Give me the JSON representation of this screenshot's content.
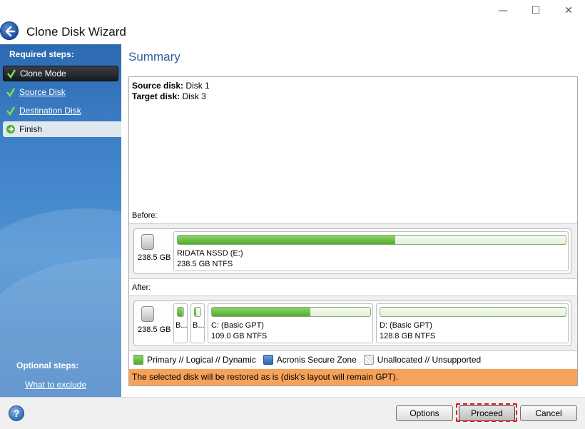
{
  "window": {
    "minimize_glyph": "—",
    "maximize_glyph": "☐",
    "close_glyph": "✕"
  },
  "header": {
    "title": "Clone Disk Wizard"
  },
  "sidebar": {
    "required_heading": "Required steps:",
    "steps": [
      {
        "label": "Clone Mode",
        "state": "completed"
      },
      {
        "label": "Source Disk",
        "state": "completed"
      },
      {
        "label": "Destination Disk",
        "state": "completed"
      },
      {
        "label": "Finish",
        "state": "current"
      }
    ],
    "optional_heading": "Optional steps:",
    "optional_link": "What to exclude"
  },
  "summary": {
    "title": "Summary",
    "source_label": "Source disk:",
    "source_value": " Disk 1",
    "target_label": "Target disk:",
    "target_value": " Disk 3",
    "before_label": "Before:",
    "after_label": "After:",
    "before": {
      "disk_size": "238.5 GB",
      "partitions": [
        {
          "name": "RIDATA NSSD (E:)",
          "info": "238.5 GB  NTFS",
          "used_fraction": 0.56
        }
      ]
    },
    "after": {
      "disk_size": "238.5 GB",
      "partitions": [
        {
          "name": "B...",
          "info": "",
          "used_fraction": 0.9
        },
        {
          "name": "B...",
          "info": "",
          "used_fraction": 0.2
        },
        {
          "name": "C: (Basic GPT)",
          "info": "109.0 GB  NTFS",
          "used_fraction": 0.62
        },
        {
          "name": "D: (Basic GPT)",
          "info": "128.8 GB  NTFS",
          "used_fraction": 0.0
        }
      ]
    },
    "legend": [
      {
        "label": "Primary // Logical // Dynamic",
        "kind": "primary"
      },
      {
        "label": "Acronis Secure Zone",
        "kind": "acronis"
      },
      {
        "label": "Unallocated // Unsupported",
        "kind": "unallocated"
      }
    ],
    "notice": "The selected disk will be restored as is (disk's layout will remain GPT).",
    "notice_color": "#f6a25a"
  },
  "buttons": {
    "help": "?",
    "options": "Options",
    "proceed": "Proceed",
    "cancel": "Cancel"
  }
}
